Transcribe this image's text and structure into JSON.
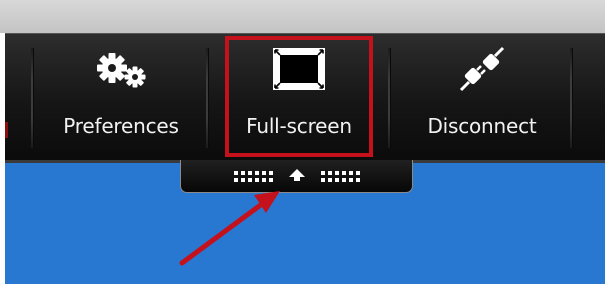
{
  "toolbar": {
    "buttons": [
      {
        "label": "Preferences",
        "icon": "gears-icon"
      },
      {
        "label": "Full-screen",
        "icon": "fullscreen-icon",
        "highlighted": true
      },
      {
        "label": "Disconnect",
        "icon": "unplug-icon"
      }
    ]
  },
  "pull_tab": {
    "icon": "up-arrow-icon"
  },
  "colors": {
    "highlight": "#c4111b",
    "toolbar_bg": "#151515",
    "desktop_bg": "#2878d2",
    "label_text": "#f2f2f2"
  }
}
